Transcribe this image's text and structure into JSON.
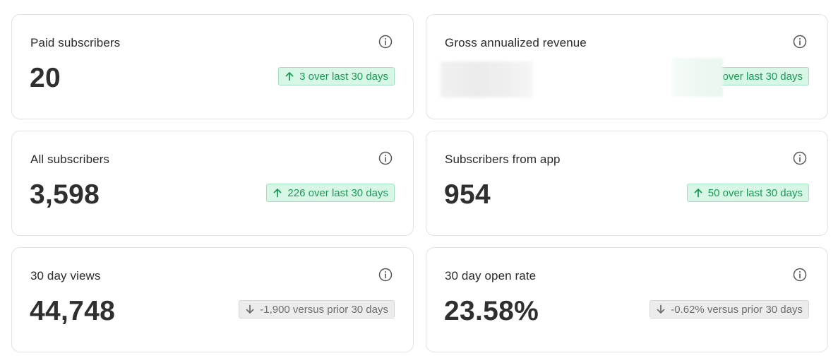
{
  "colors": {
    "positive_text": "#1b9a57",
    "positive_bg": "#d7f6e5",
    "neutral_text": "#6f6f6f",
    "neutral_bg": "#ececec"
  },
  "cards": [
    {
      "label": "Paid subscribers",
      "value": "20",
      "change": "3 over last 30 days",
      "direction": "up",
      "icon": "arrow-up-icon"
    },
    {
      "label": "Gross annualized revenue",
      "value": "",
      "change": "over last 30 days",
      "direction": "up",
      "redacted": true
    },
    {
      "label": "All subscribers",
      "value": "3,598",
      "change": "226 over last 30 days",
      "direction": "up",
      "icon": "arrow-up-icon"
    },
    {
      "label": "Subscribers from app",
      "value": "954",
      "change": "50 over last 30 days",
      "direction": "up",
      "icon": "arrow-up-icon"
    },
    {
      "label": "30 day views",
      "value": "44,748",
      "change": "-1,900 versus prior 30 days",
      "direction": "down",
      "icon": "arrow-down-icon"
    },
    {
      "label": "30 day open rate",
      "value": "23.58%",
      "change": "-0.62% versus prior 30 days",
      "direction": "down",
      "icon": "arrow-down-icon"
    }
  ]
}
